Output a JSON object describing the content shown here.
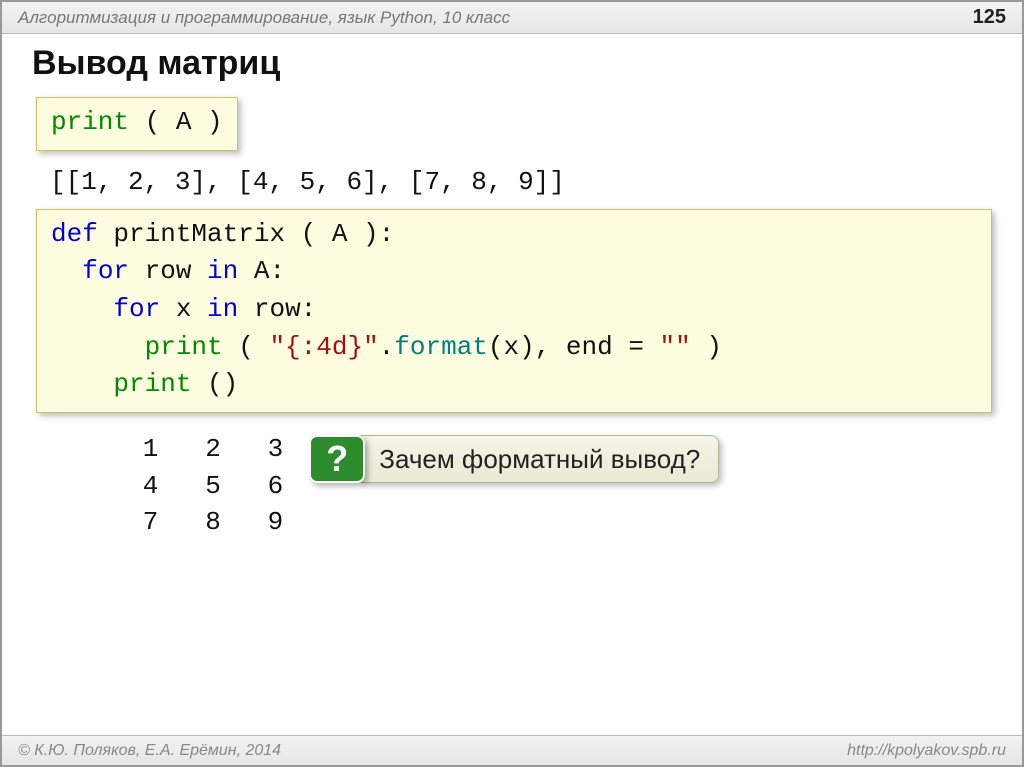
{
  "header": {
    "breadcrumb": "Алгоритмизация и программирование, язык Python, 10 класс",
    "page_number": "125"
  },
  "title": "Вывод матриц",
  "code_box1": {
    "segments": [
      {
        "cls": "kw-green",
        "t": "print"
      },
      {
        "cls": "plain",
        "t": " ( A )"
      }
    ]
  },
  "raw_output": "[[1, 2, 3], [4, 5, 6], [7, 8, 9]]",
  "code_box2": {
    "lines": [
      [
        {
          "cls": "kw-blue",
          "t": "def"
        },
        {
          "cls": "plain",
          "t": " printMatrix ( A ):"
        }
      ],
      [
        {
          "cls": "plain",
          "t": "  "
        },
        {
          "cls": "kw-blue",
          "t": "for"
        },
        {
          "cls": "plain",
          "t": " row "
        },
        {
          "cls": "kw-blue",
          "t": "in"
        },
        {
          "cls": "plain",
          "t": " A:"
        }
      ],
      [
        {
          "cls": "plain",
          "t": "    "
        },
        {
          "cls": "kw-blue",
          "t": "for"
        },
        {
          "cls": "plain",
          "t": " x "
        },
        {
          "cls": "kw-blue",
          "t": "in"
        },
        {
          "cls": "plain",
          "t": " row:"
        }
      ],
      [
        {
          "cls": "plain",
          "t": "      "
        },
        {
          "cls": "kw-green",
          "t": "print"
        },
        {
          "cls": "plain",
          "t": " ( "
        },
        {
          "cls": "kw-red",
          "t": "\"{:4d}\""
        },
        {
          "cls": "plain",
          "t": "."
        },
        {
          "cls": "kw-teal",
          "t": "format"
        },
        {
          "cls": "plain",
          "t": "(x), end = "
        },
        {
          "cls": "kw-red",
          "t": "\"\""
        },
        {
          "cls": "plain",
          "t": " )"
        }
      ],
      [
        {
          "cls": "plain",
          "t": "    "
        },
        {
          "cls": "kw-green",
          "t": "print"
        },
        {
          "cls": "plain",
          "t": " ()"
        }
      ]
    ]
  },
  "matrix_output": "   1   2   3\n   4   5   6\n   7   8   9",
  "question": {
    "badge": "?",
    "text": "Зачем форматный вывод?"
  },
  "footer": {
    "left": "© К.Ю. Поляков, Е.А. Ерёмин, 2014",
    "right": "http://kpolyakov.spb.ru"
  }
}
